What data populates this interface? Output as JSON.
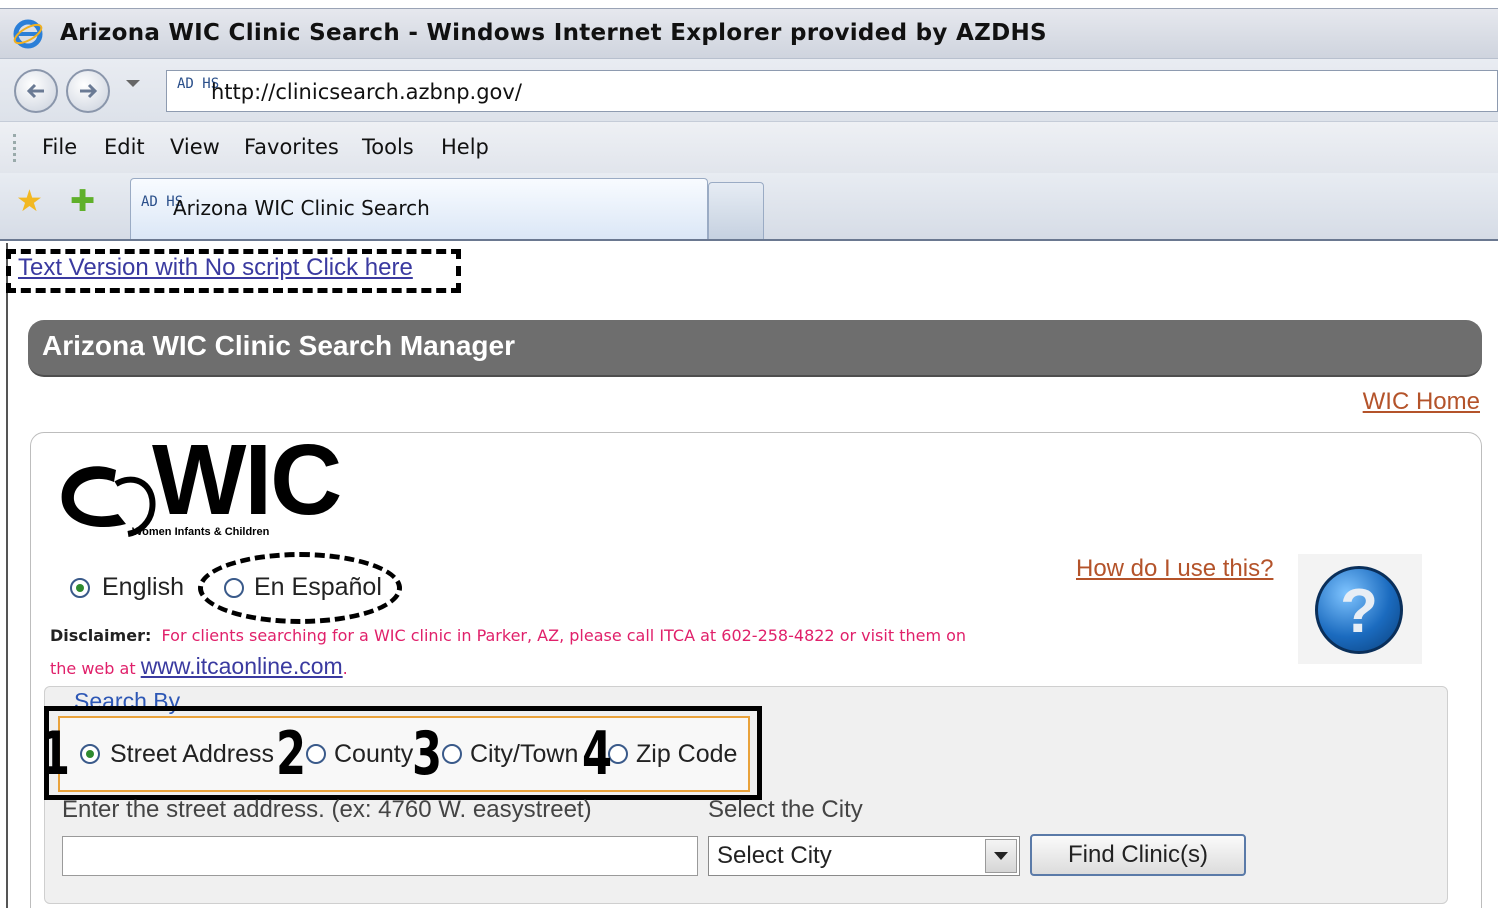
{
  "browser": {
    "window_title": "Arizona WIC Clinic Search - Windows Internet Explorer provided by AZDHS",
    "url": "http://clinicsearch.azbnp.gov/",
    "favicon_text": "AD HS",
    "menu": [
      "File",
      "Edit",
      "View",
      "Favorites",
      "Tools",
      "Help"
    ],
    "tab_title": "Arizona WIC Clinic Search"
  },
  "page": {
    "text_version_link": "Text Version with No script Click here",
    "header_title": "Arizona WIC Clinic Search Manager",
    "wic_home_link": "WIC Home",
    "logo": {
      "text": "WIC",
      "subtitle": "Women Infants & Children"
    },
    "language": {
      "options": [
        {
          "label": "English",
          "checked": true
        },
        {
          "label": "En Español",
          "checked": false
        }
      ]
    },
    "help_link": "How do I use this?",
    "help_icon_glyph": "?",
    "disclaimer": {
      "label": "Disclaimer:",
      "text_part1": "For clients searching for a WIC clinic in Parker, AZ, please call ITCA at 602-258-4822 or visit them on the web at",
      "link": "www.itcaonline.com",
      "text_end": "."
    },
    "search": {
      "legend": "Search By",
      "options": [
        {
          "label": "Street Address",
          "checked": true,
          "annotation": "1"
        },
        {
          "label": "County",
          "checked": false,
          "annotation": "2"
        },
        {
          "label": "City/Town",
          "checked": false,
          "annotation": "3"
        },
        {
          "label": "Zip Code",
          "checked": false,
          "annotation": "4"
        }
      ],
      "address_label": "Enter the street address. (ex: 4760 W. easystreet)",
      "address_value": "",
      "city_label": "Select the City",
      "city_selected": "Select City",
      "find_button": "Find Clinic(s)"
    }
  }
}
